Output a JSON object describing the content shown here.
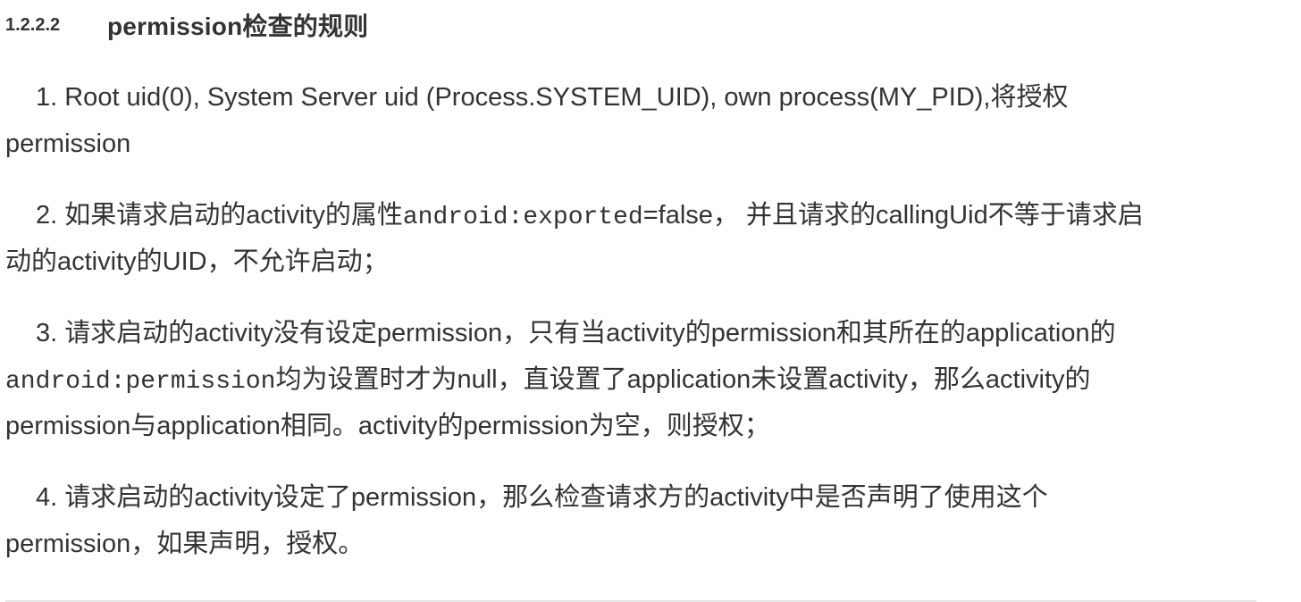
{
  "heading": {
    "number": "1.2.2.2",
    "title": "permission检查的规则"
  },
  "rules": [
    {
      "lines": [
        [
          {
            "t": "text",
            "v": "1. Root uid(0), System Server uid (Process.SYSTEM_UID), own process(MY_PID),将授权"
          }
        ],
        [
          {
            "t": "text",
            "v": "permission"
          }
        ]
      ]
    },
    {
      "lines": [
        [
          {
            "t": "text",
            "v": "2. 如果请求启动的activity的属性"
          },
          {
            "t": "code",
            "v": "android:exported"
          },
          {
            "t": "text",
            "v": "=false， 并且请求的callingUid不等于请求启"
          }
        ],
        [
          {
            "t": "text",
            "v": "动的activity的UID，不允许启动；"
          }
        ]
      ]
    },
    {
      "lines": [
        [
          {
            "t": "text",
            "v": "3. 请求启动的activity没有设定permission，只有当activity的permission和其所在的application的"
          }
        ],
        [
          {
            "t": "code",
            "v": "android:permission"
          },
          {
            "t": "text",
            "v": "均为设置时才为null，直设置了application未设置activity，那么activity的"
          }
        ],
        [
          {
            "t": "text",
            "v": "permission与application相同。activity的permission为空，则授权；"
          }
        ]
      ]
    },
    {
      "lines": [
        [
          {
            "t": "text",
            "v": "4. 请求启动的activity设定了permission，那么检查请求方的activity中是否声明了使用这个"
          }
        ],
        [
          {
            "t": "text",
            "v": "permission，如果声明，授权。"
          }
        ]
      ]
    }
  ]
}
